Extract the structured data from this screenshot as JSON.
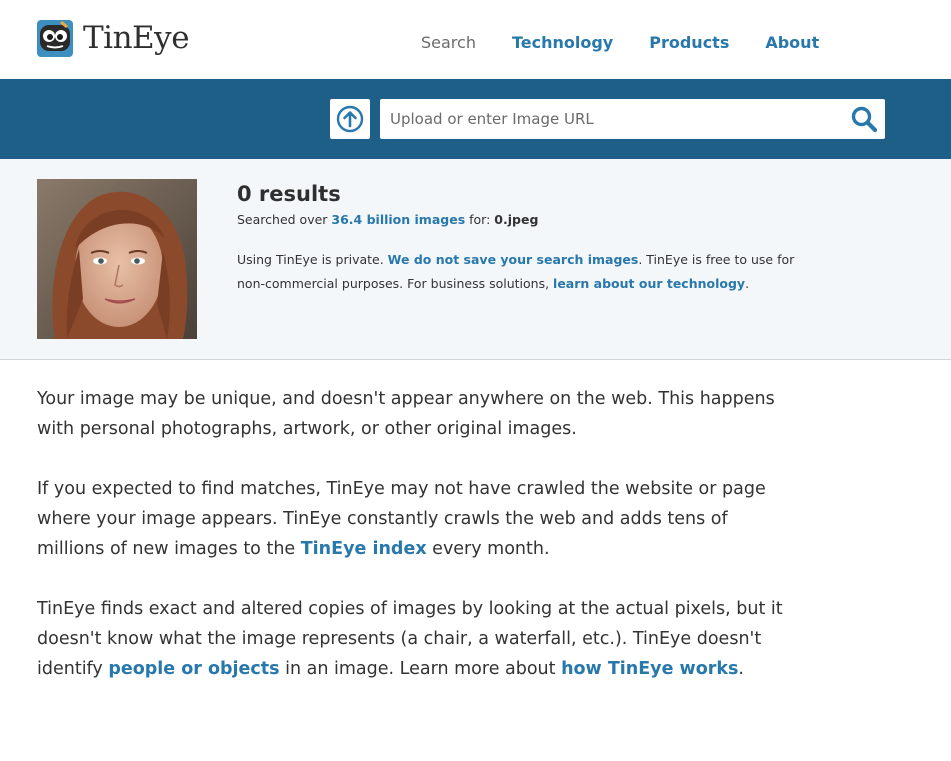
{
  "header": {
    "logo_text": "TinEye",
    "nav": {
      "search": "Search",
      "technology": "Technology",
      "products": "Products",
      "about": "About"
    }
  },
  "search": {
    "placeholder": "Upload or enter Image URL",
    "upload_icon": "upload-arrow-icon",
    "search_icon": "magnifier-icon"
  },
  "result": {
    "count": "0 results",
    "searched_prefix": "Searched over ",
    "searched_link": "36.4 billion images",
    "searched_mid": " for: ",
    "filename": "0.jpeg",
    "privacy_text1": "Using TinEye is private. ",
    "privacy_link1": "We do not save your search images",
    "privacy_text2": ". TinEye is free to use for non-commercial purposes. For business solutions, ",
    "privacy_link2": "learn about our technology",
    "privacy_text3": "."
  },
  "content": {
    "p1": "Your image may be unique, and doesn't appear anywhere on the web. This happens with personal photographs, artwork, or other original images.",
    "p2_text1": "If you expected to find matches, TinEye may not have crawled the website or page where your image appears. TinEye constantly crawls the web and adds tens of millions of new images to the ",
    "p2_link": "TinEye index",
    "p2_text2": " every month.",
    "p3_text1": "TinEye finds exact and altered copies of images by looking at the actual pixels, but it doesn't know what the image represents (a chair, a waterfall, etc.). TinEye doesn't identify ",
    "p3_link1": "people or objects",
    "p3_text2": " in an image. Learn more about ",
    "p3_link2": "how TinEye works",
    "p3_text3": "."
  },
  "colors": {
    "brand_blue": "#1d5f87",
    "link_blue": "#2878ab",
    "panel_bg": "#f4f7fa"
  }
}
